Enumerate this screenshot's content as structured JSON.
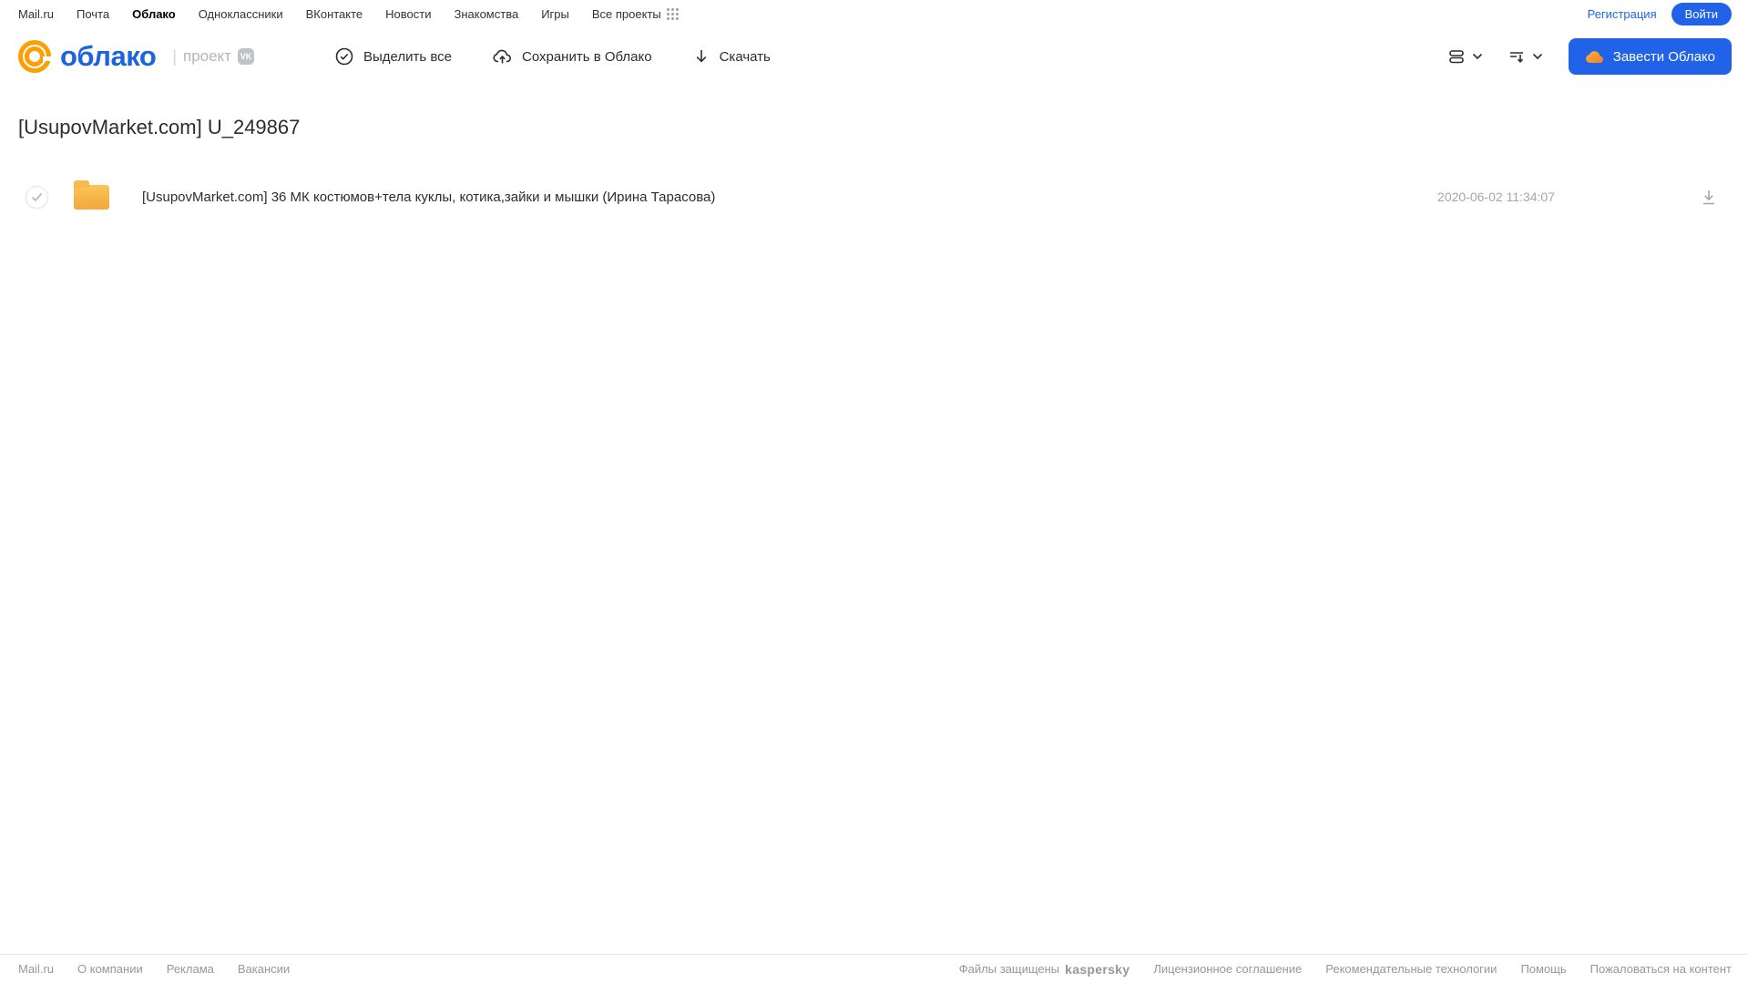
{
  "top_nav": {
    "links": [
      {
        "label": "Mail.ru",
        "active": false
      },
      {
        "label": "Почта",
        "active": false
      },
      {
        "label": "Облако",
        "active": true
      },
      {
        "label": "Одноклассники",
        "active": false
      },
      {
        "label": "ВКонтакте",
        "active": false
      },
      {
        "label": "Новости",
        "active": false
      },
      {
        "label": "Знакомства",
        "active": false
      },
      {
        "label": "Игры",
        "active": false
      },
      {
        "label": "Все проекты",
        "active": false
      }
    ],
    "register_label": "Регистрация",
    "login_label": "Войти"
  },
  "header": {
    "logo_text": "облако",
    "project_label": "проект",
    "project_badge": "VK",
    "toolbar": [
      {
        "label": "Выделить все",
        "icon": "check-circle-icon"
      },
      {
        "label": "Сохранить в Облако",
        "icon": "cloud-upload-icon"
      },
      {
        "label": "Скачать",
        "icon": "download-icon"
      }
    ],
    "get_cloud_label": "Завести Облако"
  },
  "main": {
    "title": "[UsupovMarket.com] U_249867",
    "files": [
      {
        "type": "folder",
        "name": "[UsupovMarket.com] 36 МК костюмов+тела куклы, котика,зайки и мышки (Ирина Тарасова)",
        "date": "2020-06-02 11:34:07"
      }
    ]
  },
  "footer": {
    "left_links": [
      "Mail.ru",
      "О компании",
      "Реклама",
      "Вакансии"
    ],
    "protected_label": "Файлы защищены",
    "kaspersky_label": "kaspersky",
    "right_links": [
      "Лицензионное соглашение",
      "Рекомендательные технологии",
      "Помощь",
      "Пожаловаться на контент"
    ]
  },
  "colors": {
    "accent_blue": "#2163e8",
    "logo_blue": "#1b64dd",
    "logo_orange": "#ff9e00",
    "folder_orange": "#f3a73f",
    "kaspersky_teal": "#00806e"
  }
}
